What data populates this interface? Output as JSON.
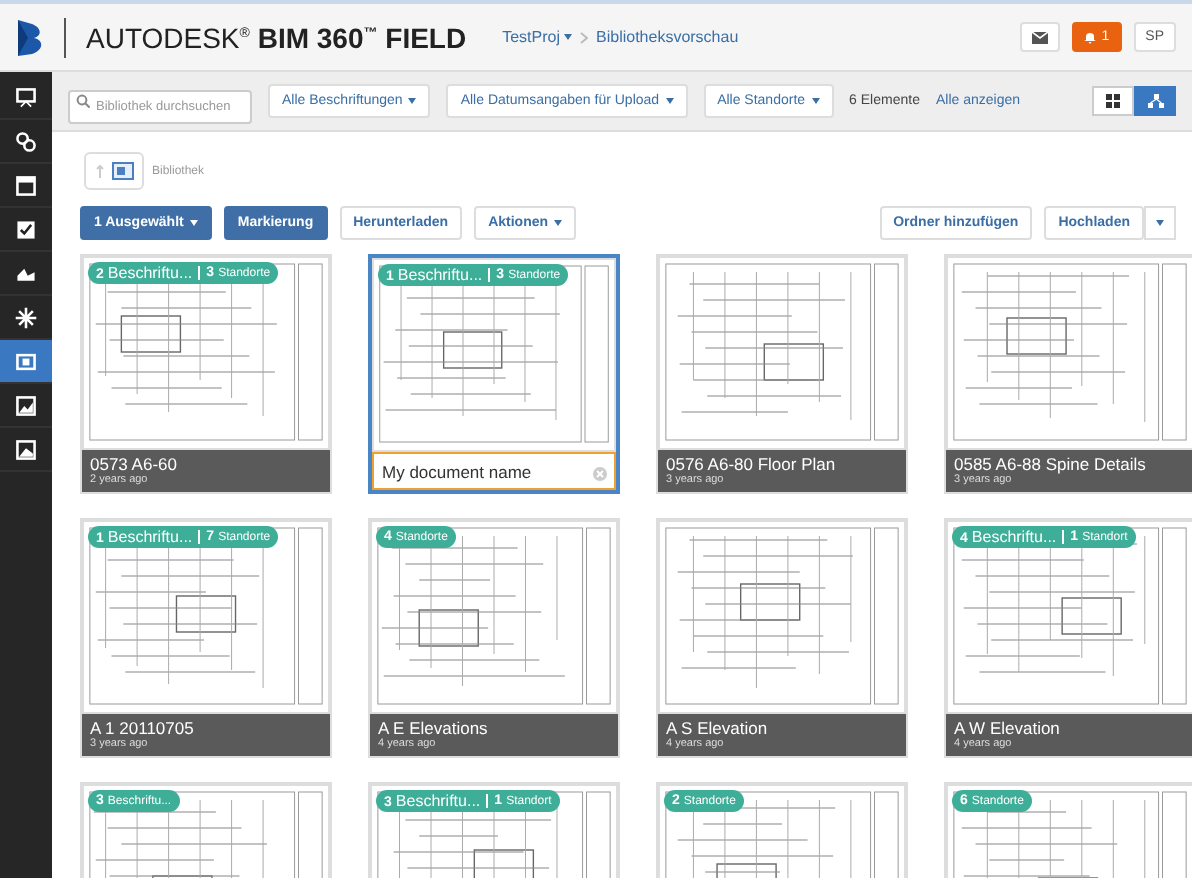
{
  "header": {
    "brand": "AUTODESK$^{®}$ **BIM 360$^{™}$ FIELD**",
    "breadcrumb": [
      {
        "label": "TestProj",
        "dropdown": true
      },
      {
        "label": "Bibliotheksvorschau",
        "dropdown": false
      }
    ],
    "notifications": "1",
    "user": "SP"
  },
  "sidebar": {
    "items": [
      {
        "selected": false
      },
      {
        "selected": false
      },
      {
        "selected": false
      },
      {
        "selected": false
      },
      {
        "selected": false
      },
      {
        "selected": false
      },
      {
        "selected": true
      },
      {
        "selected": false
      },
      {
        "selected": false
      }
    ]
  },
  "filters": {
    "search": {
      "placeholder": "Bibliothek durchsuchen"
    },
    "dropdowns": [
      "Alle Beschriftungen",
      "Alle Datumsangaben für Upload",
      "Alle Standorte"
    ],
    "count": "6 Elemente",
    "show_all": "Alle anzeigen",
    "views": [
      {
        "kind": "grid",
        "selected": false
      },
      {
        "kind": "tree",
        "selected": true
      }
    ]
  },
  "location": {
    "label": "Bibliothek"
  },
  "actions": {
    "left": [
      {
        "label": "1 Ausgewählt",
        "primary": true,
        "dropdown": true
      },
      {
        "label": "Markierung",
        "primary": true,
        "dropdown": false
      },
      {
        "label": "Herunterladen",
        "primary": false,
        "dropdown": false
      },
      {
        "label": "Aktionen",
        "primary": false,
        "dropdown": true
      }
    ],
    "right": [
      {
        "label": "Ordner hinzufügen",
        "split": false
      },
      {
        "label": "Hochladen",
        "split": true
      }
    ]
  },
  "cards": [
    {
      "title": "0573 A6-60",
      "age": "2 years ago",
      "selected": false,
      "badge": [
        {
          "count": "2",
          "text": "Beschriftu..."
        },
        {
          "count": "3",
          "text": "Standorte"
        }
      ]
    },
    {
      "title": "My document name",
      "selected": true,
      "badge": [
        {
          "count": "1",
          "text": "Beschriftu..."
        },
        {
          "count": "3",
          "text": "Standorte"
        }
      ]
    },
    {
      "title": "0576 A6-80 Floor Plan",
      "age": "3 years ago",
      "selected": false
    },
    {
      "title": "0585 A6-88 Spine Details",
      "age": "3 years ago",
      "selected": false
    },
    {
      "title": "A 1 20110705",
      "age": "3 years ago",
      "selected": false,
      "badge": [
        {
          "count": "1",
          "text": "Beschriftu..."
        },
        {
          "count": "7",
          "text": "Standorte"
        }
      ]
    },
    {
      "title": "A E Elevations",
      "age": "4 years ago",
      "selected": false,
      "badge": [
        {
          "count": "4",
          "text": "Standorte"
        }
      ]
    },
    {
      "title": "A S Elevation",
      "age": "4 years ago",
      "selected": false
    },
    {
      "title": "A W Elevation",
      "age": "4 years ago",
      "selected": false,
      "badge": [
        {
          "count": "4",
          "text": "Beschriftu..."
        },
        {
          "count": "1",
          "text": "Standort"
        }
      ]
    },
    {
      "selected": false,
      "badge": [
        {
          "count": "3",
          "text": "Beschriftu..."
        }
      ]
    },
    {
      "selected": false,
      "badge": [
        {
          "count": "3",
          "text": "Beschriftu..."
        },
        {
          "count": "1",
          "text": "Standort"
        }
      ]
    },
    {
      "selected": false,
      "badge": [
        {
          "count": "2",
          "text": "Standorte"
        }
      ]
    },
    {
      "selected": false,
      "badge": [
        {
          "count": "6",
          "text": "Standorte"
        }
      ]
    }
  ]
}
